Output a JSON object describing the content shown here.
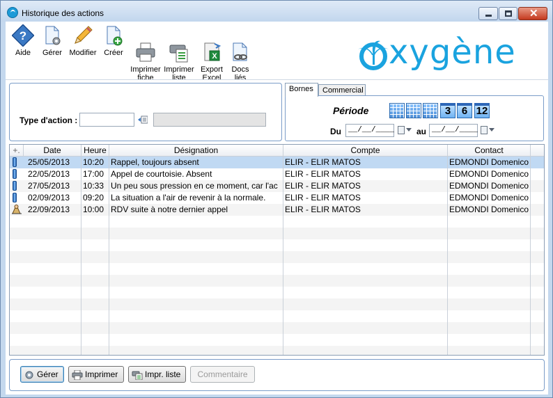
{
  "window": {
    "title": "Historique des actions"
  },
  "toolbar": {
    "buttons": [
      {
        "label": "Aide",
        "icon": "help-icon"
      },
      {
        "label": "Gérer",
        "icon": "manage-document-icon"
      },
      {
        "label": "Modifier",
        "icon": "pencil-icon"
      },
      {
        "label": "Créer",
        "icon": "create-document-icon"
      },
      {
        "label": "Imprimer\nfiche",
        "icon": "printer-icon"
      },
      {
        "label": "Imprimer\nliste",
        "icon": "print-list-icon"
      },
      {
        "label": "Export\nExcel",
        "icon": "excel-export-icon"
      },
      {
        "label": "Docs\nliés",
        "icon": "linked-docs-icon"
      }
    ]
  },
  "logo": {
    "text": "xygène",
    "color": "#1aa3df"
  },
  "filter": {
    "type_label": "Type d'action :",
    "type_value": "",
    "type_description": ""
  },
  "tabs": [
    {
      "label": "Bornes"
    },
    {
      "label": "Commercial"
    }
  ],
  "period": {
    "label": "Période",
    "buttons": [
      "",
      "",
      "",
      "3",
      "6",
      "12"
    ],
    "du_label": "Du",
    "au_label": "au",
    "du_value": "__/__/____",
    "au_value": "__/__/____"
  },
  "grid": {
    "add_symbol": "+.",
    "columns": [
      "Date",
      "Heure",
      "Désignation",
      "Compte",
      "Contact"
    ],
    "rows": [
      {
        "type": "phone",
        "date": "25/05/2013",
        "heure": "10:20",
        "designation": "Rappel, toujours absent",
        "compte": "ELIR - ELIR MATOS",
        "contact": "EDMONDI Domenico"
      },
      {
        "type": "phone",
        "date": "22/05/2013",
        "heure": "17:00",
        "designation": "Appel de courtoisie. Absent",
        "compte": "ELIR - ELIR MATOS",
        "contact": "EDMONDI Domenico"
      },
      {
        "type": "phone",
        "date": "27/05/2013",
        "heure": "10:33",
        "designation": "Un peu sous pression en ce moment, car l'ac",
        "compte": "ELIR - ELIR MATOS",
        "contact": "EDMONDI Domenico"
      },
      {
        "type": "phone",
        "date": "02/09/2013",
        "heure": "09:20",
        "designation": "La situation a l'air de revenir à la normale.",
        "compte": "ELIR - ELIR MATOS",
        "contact": "EDMONDI Domenico"
      },
      {
        "type": "rdv",
        "date": "22/09/2013",
        "heure": "10:00",
        "designation": "RDV suite à notre dernier appel",
        "compte": "ELIR - ELIR MATOS",
        "contact": "EDMONDI Domenico"
      }
    ]
  },
  "bottom": {
    "gerer": "Gérer",
    "imprimer": "Imprimer",
    "impr_liste": "Impr. liste",
    "commentaire": "Commentaire"
  }
}
